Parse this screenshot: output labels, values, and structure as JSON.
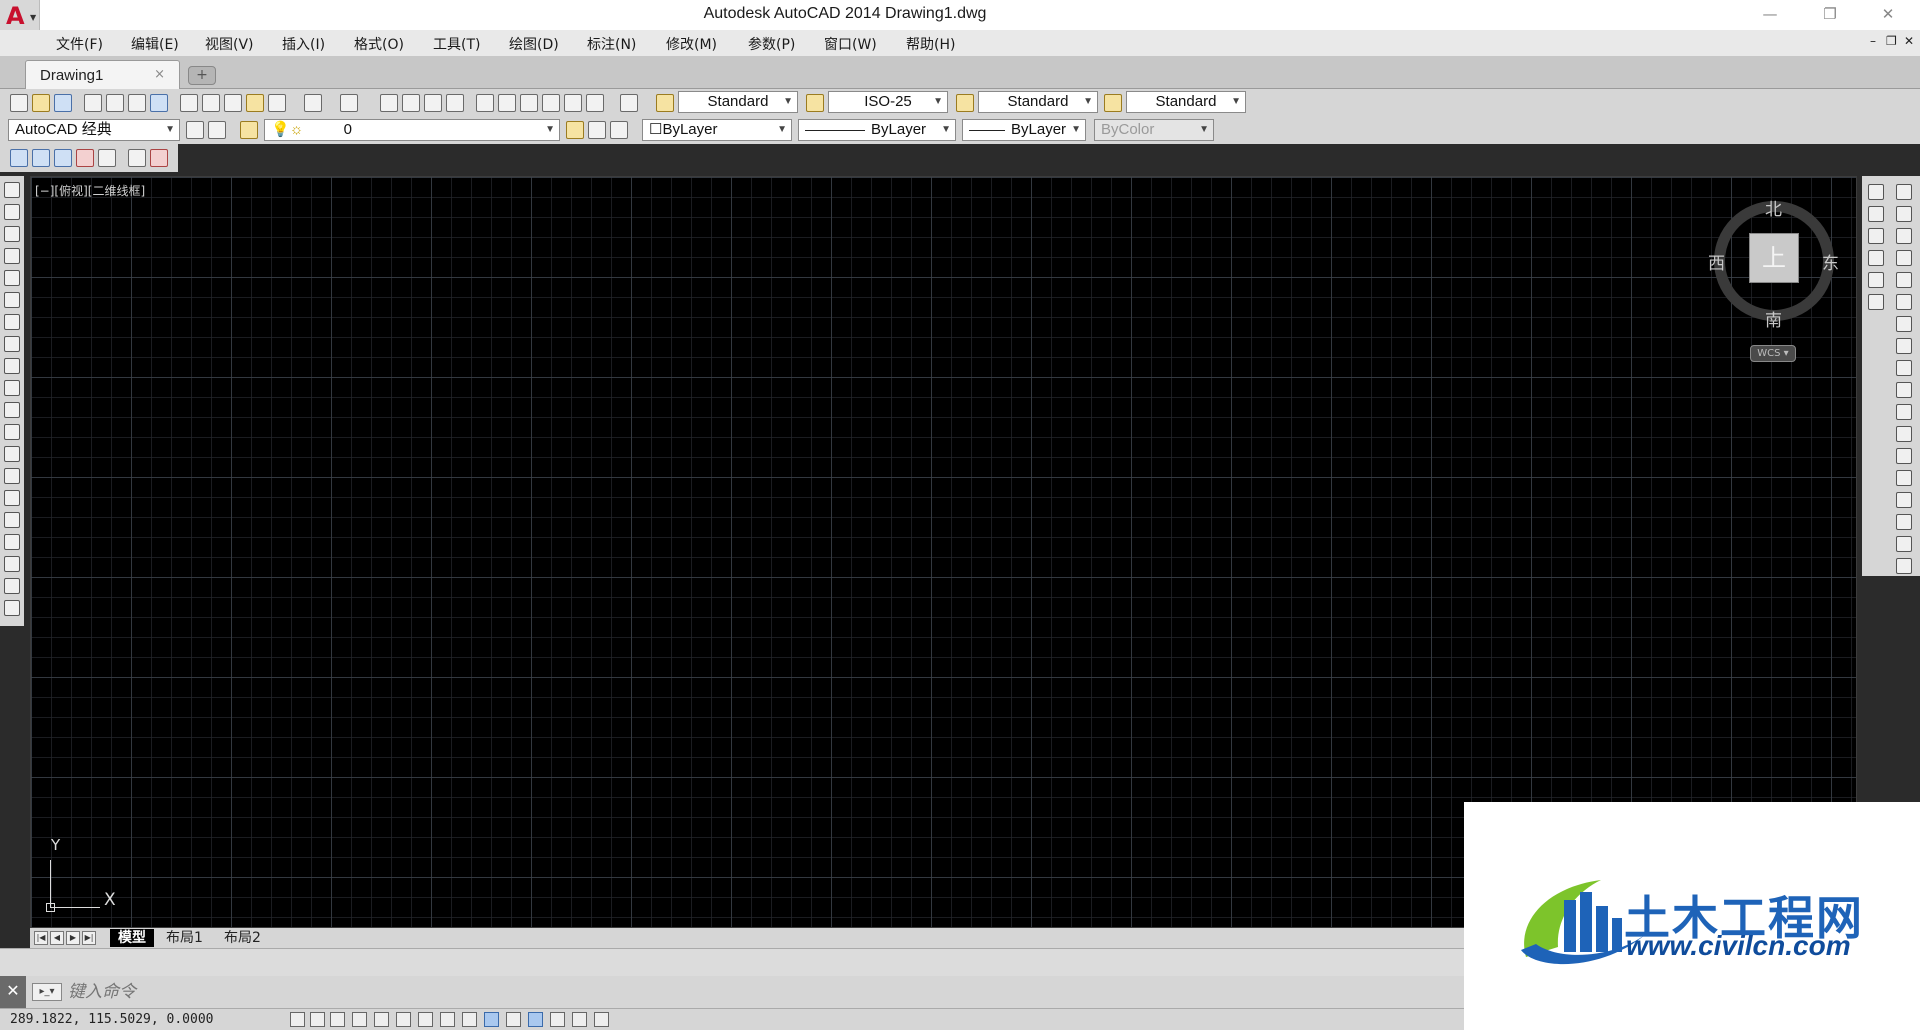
{
  "titlebar": {
    "title": "Autodesk AutoCAD 2014    Drawing1.dwg",
    "logo_letter": "A",
    "minimize_icon": "minimize-icon",
    "restore_icon": "restore-icon",
    "close_icon": "close-icon"
  },
  "menu": {
    "items": [
      "文件(F)",
      "编辑(E)",
      "视图(V)",
      "插入(I)",
      "格式(O)",
      "工具(T)",
      "绘图(D)",
      "标注(N)",
      "修改(M)",
      "参数(P)",
      "窗口(W)",
      "帮助(H)"
    ]
  },
  "tabs": {
    "active": "Drawing1",
    "close_glyph": "×",
    "new_glyph": "+"
  },
  "toolbar": {
    "text_style": "Standard",
    "dim_style": "ISO-25",
    "table_style": "Standard",
    "multileader_style": "Standard",
    "workspace": "AutoCAD 经典",
    "layer": "0",
    "color": "ByLayer",
    "linetype": "ByLayer",
    "lineweight": "ByLayer",
    "plotstyle": "ByColor"
  },
  "viewport": {
    "label": "[−][俯视][二维线框]",
    "viewcube": {
      "north": "北",
      "south": "南",
      "east": "东",
      "west": "西",
      "face": "上",
      "wcs": "WCS"
    },
    "ucs": {
      "x": "X",
      "y": "Y"
    }
  },
  "layouts": [
    "模型",
    "布局1",
    "布局2"
  ],
  "command": {
    "placeholder": "键入命令",
    "close_glyph": "✕"
  },
  "status": {
    "coordinates": "289.1822, 115.5029, 0.0000"
  },
  "watermark": {
    "name": "土木工程网",
    "url": "www.civilcn.com"
  },
  "colors": {
    "drawing_bg": "#000000",
    "brand_red": "#c8102e",
    "watermark_blue": "#1e63b8",
    "watermark_green": "#7dc42b"
  }
}
